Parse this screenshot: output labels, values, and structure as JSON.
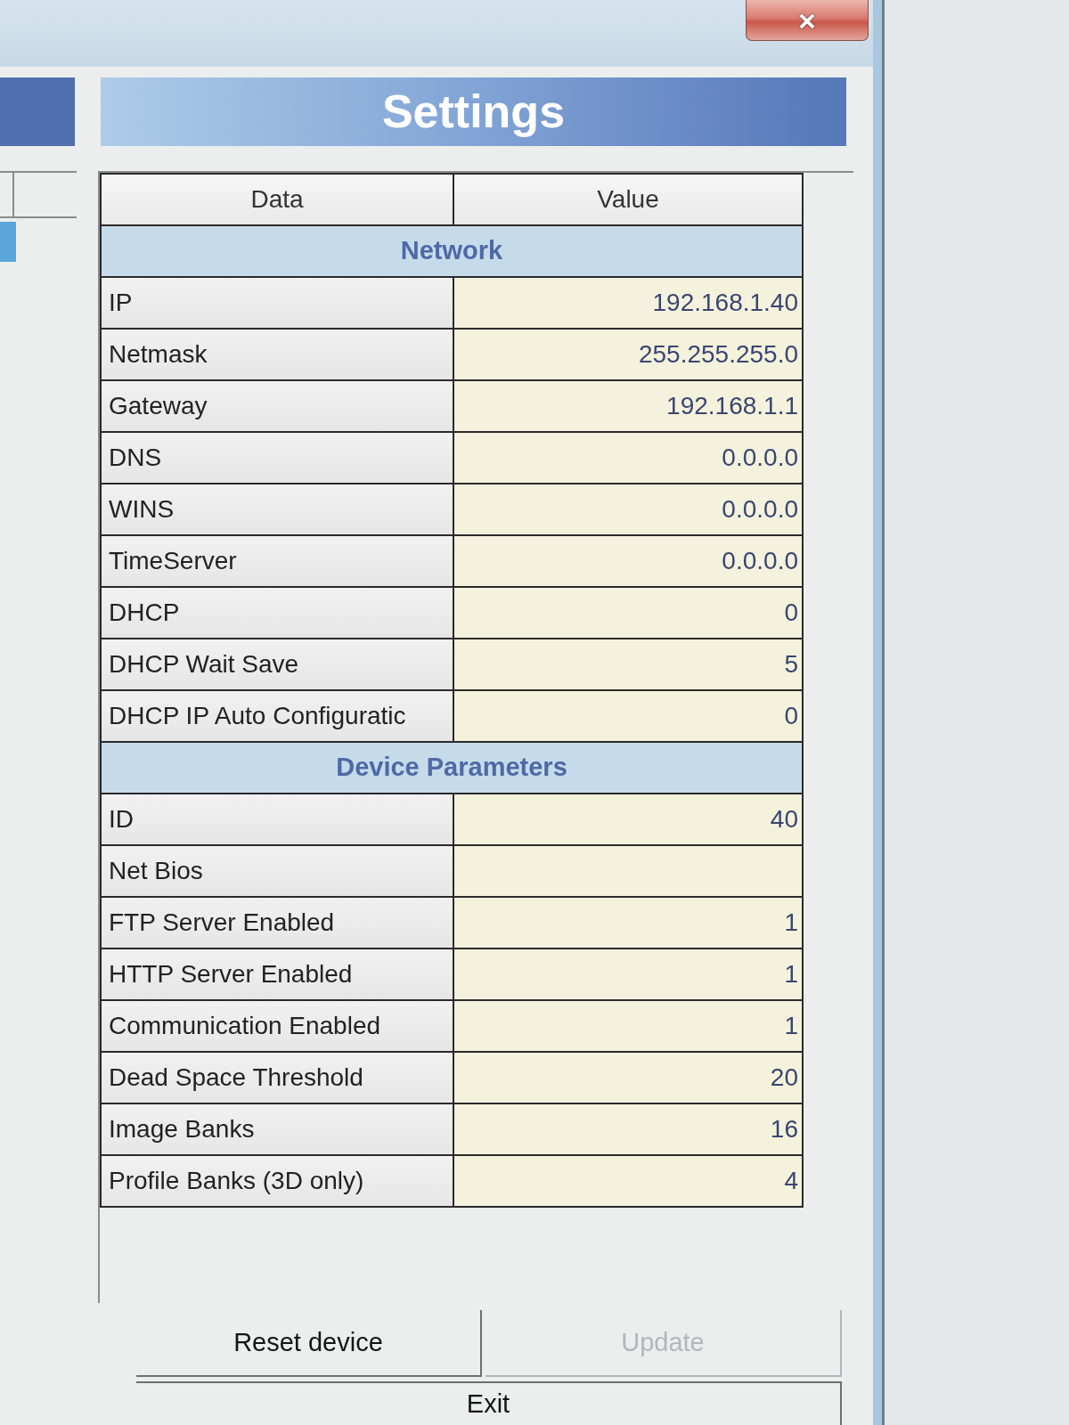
{
  "window": {
    "close": "×"
  },
  "panel": {
    "title": "Settings"
  },
  "table": {
    "columns": [
      "Data",
      "Value"
    ],
    "sections": [
      {
        "title": "Network",
        "rows": [
          {
            "name": "IP",
            "value": "192.168.1.40"
          },
          {
            "name": "Netmask",
            "value": "255.255.255.0"
          },
          {
            "name": "Gateway",
            "value": "192.168.1.1"
          },
          {
            "name": "DNS",
            "value": "0.0.0.0"
          },
          {
            "name": "WINS",
            "value": "0.0.0.0"
          },
          {
            "name": "TimeServer",
            "value": "0.0.0.0"
          },
          {
            "name": "DHCP",
            "value": "0"
          },
          {
            "name": "DHCP Wait Save",
            "value": "5"
          },
          {
            "name": "DHCP IP Auto Configuratic",
            "value": "0"
          }
        ]
      },
      {
        "title": "Device Parameters",
        "rows": [
          {
            "name": "ID",
            "value": "40"
          },
          {
            "name": "Net Bios"
          },
          {
            "name": "FTP Server Enabled",
            "value": "1"
          },
          {
            "name": "HTTP Server Enabled",
            "value": "1"
          },
          {
            "name": "Communication Enabled",
            "value": "1"
          },
          {
            "name": "Dead Space Threshold",
            "value": "20"
          },
          {
            "name": "Image Banks",
            "value": "16"
          },
          {
            "name": "Profile Banks (3D only)",
            "value": "4"
          }
        ]
      }
    ]
  },
  "buttons": [
    {
      "label": "Reset device",
      "disabled": false
    },
    {
      "label": "Update",
      "disabled": true
    },
    {
      "label": "Exit",
      "disabled": false
    }
  ]
}
